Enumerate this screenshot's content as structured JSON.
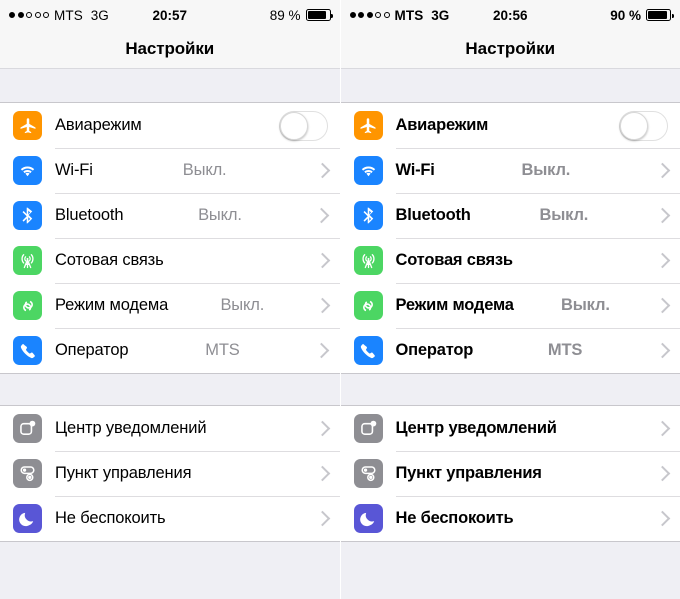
{
  "panels": [
    {
      "id": "normal-text",
      "statusbar": {
        "signal_dots_filled": 2,
        "signal_dots_total": 5,
        "carrier": "MTS",
        "network": "3G",
        "time": "20:57",
        "battery_text": "89 %",
        "battery_percent": 89
      },
      "navbar": {
        "title": "Настройки"
      },
      "groups": [
        {
          "rows": [
            {
              "icon": "airplane-icon",
              "label": "Авиарежим",
              "control": "toggle",
              "toggle_on": false
            },
            {
              "icon": "wifi-icon",
              "label": "Wi-Fi",
              "value": "Выкл.",
              "control": "chevron"
            },
            {
              "icon": "bluetooth-icon",
              "label": "Bluetooth",
              "value": "Выкл.",
              "control": "chevron"
            },
            {
              "icon": "cellular-icon",
              "label": "Сотовая связь",
              "value": "",
              "control": "chevron"
            },
            {
              "icon": "hotspot-icon",
              "label": "Режим модема",
              "value": "Выкл.",
              "control": "chevron"
            },
            {
              "icon": "carrier-icon",
              "label": "Оператор",
              "value": "MTS",
              "control": "chevron"
            }
          ]
        },
        {
          "rows": [
            {
              "icon": "notification-center-icon",
              "label": "Центр уведомлений",
              "value": "",
              "control": "chevron"
            },
            {
              "icon": "control-center-icon",
              "label": "Пункт управления",
              "value": "",
              "control": "chevron"
            },
            {
              "icon": "do-not-disturb-icon",
              "label": "Не беспокоить",
              "value": "",
              "control": "chevron"
            }
          ]
        }
      ]
    },
    {
      "id": "bold-text",
      "statusbar": {
        "signal_dots_filled": 3,
        "signal_dots_total": 5,
        "carrier": "MTS",
        "network": "3G",
        "time": "20:56",
        "battery_text": "90 %",
        "battery_percent": 90
      },
      "navbar": {
        "title": "Настройки"
      },
      "groups": [
        {
          "rows": [
            {
              "icon": "airplane-icon",
              "label": "Авиарежим",
              "control": "toggle",
              "toggle_on": false
            },
            {
              "icon": "wifi-icon",
              "label": "Wi-Fi",
              "value": "Выкл.",
              "control": "chevron"
            },
            {
              "icon": "bluetooth-icon",
              "label": "Bluetooth",
              "value": "Выкл.",
              "control": "chevron"
            },
            {
              "icon": "cellular-icon",
              "label": "Сотовая связь",
              "value": "",
              "control": "chevron"
            },
            {
              "icon": "hotspot-icon",
              "label": "Режим модема",
              "value": "Выкл.",
              "control": "chevron"
            },
            {
              "icon": "carrier-icon",
              "label": "Оператор",
              "value": "MTS",
              "control": "chevron"
            }
          ]
        },
        {
          "rows": [
            {
              "icon": "notification-center-icon",
              "label": "Центр уведомлений",
              "value": "",
              "control": "chevron"
            },
            {
              "icon": "control-center-icon",
              "label": "Пункт управления",
              "value": "",
              "control": "chevron"
            },
            {
              "icon": "do-not-disturb-icon",
              "label": "Не беспокоить",
              "value": "",
              "control": "chevron"
            }
          ]
        }
      ]
    }
  ],
  "colors": {
    "orange": "#FF9500",
    "blue": "#1A84FF",
    "green": "#4CD663",
    "gray": "#8E8E93",
    "purple": "#5956D6",
    "list_background": "#EFEFF4",
    "row_background": "#FFFFFF",
    "separator": "#C8C7CC",
    "secondary_text": "#8E8E93",
    "bar_background": "#F7F7F7"
  }
}
